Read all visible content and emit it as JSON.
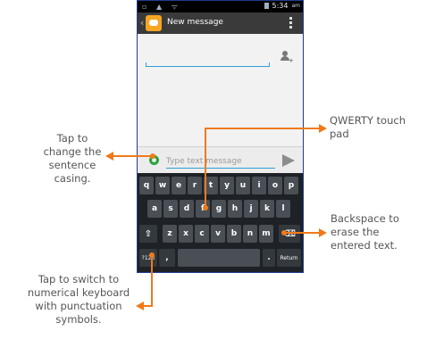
{
  "statusbar": {
    "left_icons": "▫ ▲ ᯤ",
    "time": "5:34",
    "ampm": "am"
  },
  "header": {
    "back_icon": "chevron-left-icon",
    "title": "New message",
    "menu_icon": "overflow-menu-icon"
  },
  "compose": {
    "placeholder": "Type text message",
    "send_icon": "send-icon",
    "case_icon": "sentence-case-icon"
  },
  "keyboard": {
    "row1": [
      "q",
      "w",
      "e",
      "r",
      "t",
      "y",
      "u",
      "i",
      "o",
      "p"
    ],
    "row2": [
      "a",
      "s",
      "d",
      "f",
      "g",
      "h",
      "j",
      "k",
      "l"
    ],
    "row3": [
      "z",
      "x",
      "c",
      "v",
      "b",
      "n",
      "m"
    ],
    "shift_icon": "shift-icon",
    "backspace_icon": "backspace-icon",
    "numeric_label": "?123",
    "comma_label": ",",
    "period_label": ".",
    "return_label": "Return"
  },
  "annotations": {
    "case": [
      "Tap to",
      "change the",
      "sentence",
      "casing."
    ],
    "qwerty": [
      "QWERTY touch",
      "pad"
    ],
    "backspace": [
      "Backspace to",
      "erase the",
      "entered text."
    ],
    "numeric": [
      "Tap to switch to",
      "numerical keyboard",
      "with punctuation",
      "symbols."
    ]
  },
  "colors": {
    "accent": "#f07a1a",
    "phone_border": "#1f3d8f",
    "field_underline": "#2f9ed6",
    "app_icon": "#f6a623"
  }
}
